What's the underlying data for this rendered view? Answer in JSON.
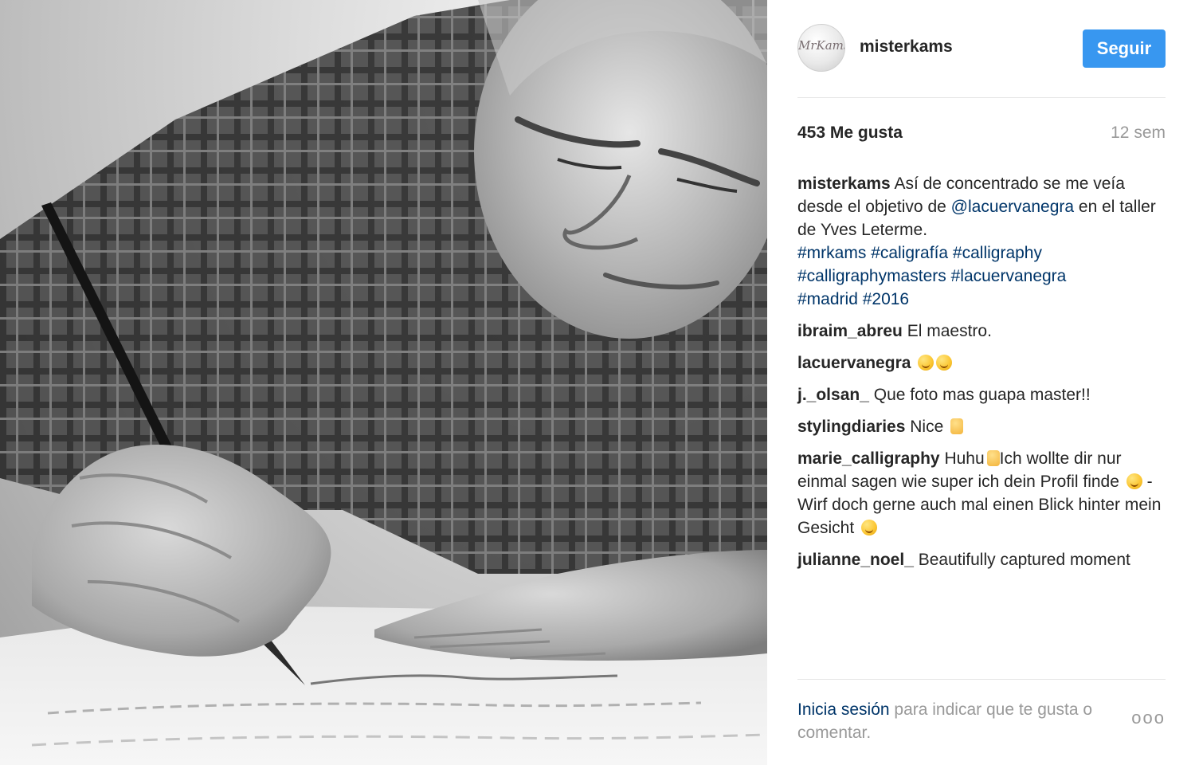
{
  "post": {
    "username": "misterkams",
    "avatar_logo": "MrKams",
    "follow_label": "Seguir",
    "likes": "453 Me gusta",
    "time": "12 sem",
    "caption": {
      "user": "misterkams",
      "text_1": "Así de concentrado se me veía desde el objetivo de",
      "mention": "@lacuervanegra",
      "text_2": "en el taller de Yves Leterme.",
      "hashtags": [
        "#mrkams",
        "#caligrafía",
        "#calligraphy",
        "#calligraphymasters",
        "#lacuervanegra",
        "#madrid",
        "#2016"
      ]
    },
    "comments": [
      {
        "user": "ibraim_abreu",
        "text": "El maestro."
      },
      {
        "user": "lacuervanegra",
        "text": ""
      },
      {
        "user": "j._olsan_",
        "text": "Que foto mas guapa master!!"
      },
      {
        "user": "stylingdiaries",
        "text": "Nice"
      },
      {
        "user": "marie_calligraphy",
        "text_1": "Huhu",
        "text_2": "Ich wollte dir nur einmal sagen wie super ich dein Profil finde",
        "text_3": "- Wirf doch gerne auch mal einen Blick hinter mein Gesicht"
      },
      {
        "user": "julianne_noel_",
        "text": "Beautifully captured moment"
      }
    ],
    "footer": {
      "login_link": "Inicia sesión",
      "login_rest": "para indicar que te gusta o comentar.",
      "more_icon": "ellipsis-icon",
      "more_label": "ooo"
    },
    "icons": {
      "avatar": "avatar-logo",
      "emoji": "smiley-emoji-icon"
    },
    "colors": {
      "accent": "#3897f0",
      "link": "#003569",
      "muted": "#999999",
      "text": "#262626"
    }
  }
}
